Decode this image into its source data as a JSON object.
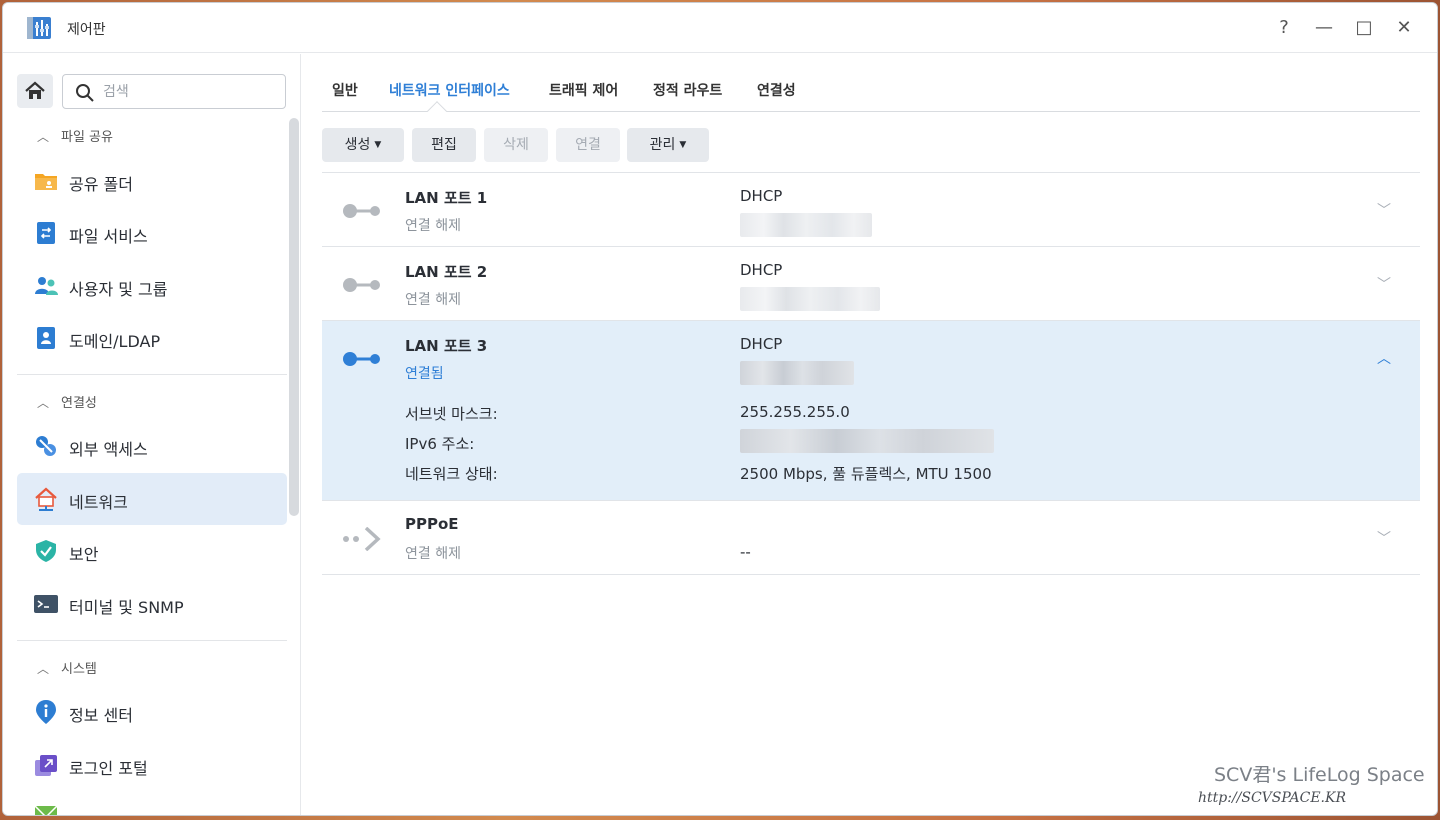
{
  "window": {
    "title": "제어판",
    "controls": {
      "help": "?",
      "minimize": "—",
      "maximize": "□",
      "close": "✕"
    }
  },
  "sidebar": {
    "search_placeholder": "검색",
    "sections": [
      {
        "label": "파일 공유",
        "items": [
          {
            "label": "공유 폴더",
            "icon": "shared-folder-icon"
          },
          {
            "label": "파일 서비스",
            "icon": "file-services-icon"
          },
          {
            "label": "사용자 및 그룹",
            "icon": "users-groups-icon"
          },
          {
            "label": "도메인/LDAP",
            "icon": "domain-ldap-icon"
          }
        ]
      },
      {
        "label": "연결성",
        "items": [
          {
            "label": "외부 액세스",
            "icon": "external-access-icon"
          },
          {
            "label": "네트워크",
            "icon": "network-icon",
            "active": true
          },
          {
            "label": "보안",
            "icon": "security-icon"
          },
          {
            "label": "터미널 및 SNMP",
            "icon": "terminal-icon"
          }
        ]
      },
      {
        "label": "시스템",
        "items": [
          {
            "label": "정보 센터",
            "icon": "info-center-icon"
          },
          {
            "label": "로그인 포털",
            "icon": "login-portal-icon"
          }
        ]
      }
    ]
  },
  "tabs": [
    {
      "label": "일반"
    },
    {
      "label": "네트워크 인터페이스",
      "active": true
    },
    {
      "label": "트래픽 제어"
    },
    {
      "label": "정적 라우트"
    },
    {
      "label": "연결성"
    }
  ],
  "toolbar": {
    "create": "생성",
    "edit": "편집",
    "delete": "삭제",
    "connect": "연결",
    "manage": "관리"
  },
  "interfaces": [
    {
      "name": "LAN 포트 1",
      "status": "연결 해제",
      "method": "DHCP",
      "connected": false,
      "expanded": false
    },
    {
      "name": "LAN 포트 2",
      "status": "연결 해제",
      "method": "DHCP",
      "connected": false,
      "expanded": false
    },
    {
      "name": "LAN 포트 3",
      "status": "연결됨",
      "method": "DHCP",
      "connected": true,
      "expanded": true,
      "details": {
        "subnet_label": "서브넷 마스크:",
        "subnet_value": "255.255.255.0",
        "ipv6_label": "IPv6 주소:",
        "state_label": "네트워크 상태:",
        "state_value": "2500 Mbps, 풀 듀플렉스, MTU 1500"
      }
    },
    {
      "name": "PPPoE",
      "status": "연결 해제",
      "method": "--",
      "connected": false,
      "expanded": false
    }
  ],
  "watermark": {
    "line1": "SCV君's LifeLog Space",
    "line2": "http://SCVSPACE.KR"
  },
  "colors": {
    "accent": "#2f7fd6",
    "selected_row": "#e2eef9",
    "active_nav": "#e2ecf8"
  }
}
